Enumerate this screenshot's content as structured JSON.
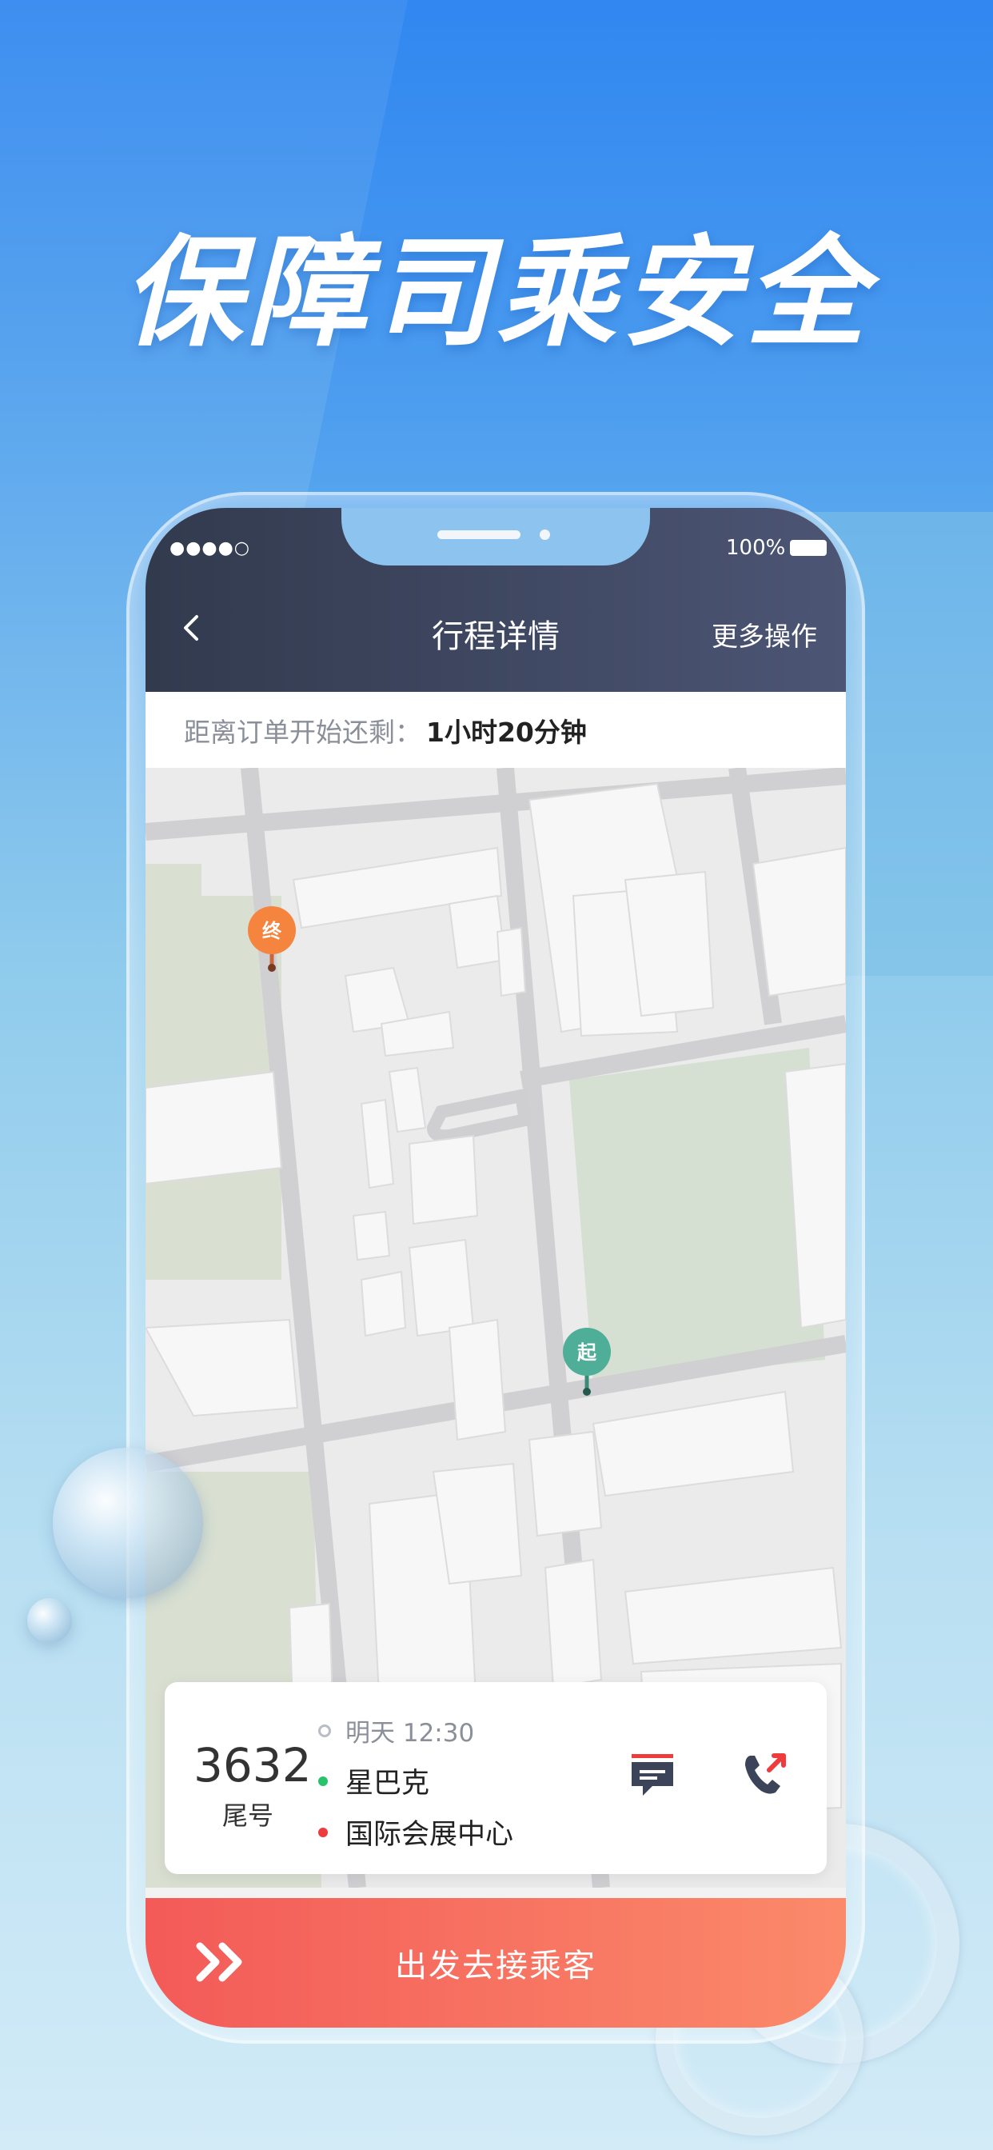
{
  "headline": "保障司乘安全",
  "status_bar": {
    "signal": "●●●●○",
    "battery_text": "100%"
  },
  "nav": {
    "title": "行程详情",
    "more_label": "更多操作"
  },
  "countdown": {
    "label": "距离订单开始还剩：",
    "value": "1小时20分钟"
  },
  "map": {
    "end_marker": "终",
    "start_marker": "起",
    "end_color": "#f5843f",
    "start_color": "#4fae98"
  },
  "trip": {
    "plate_number": "3632",
    "plate_sub": "尾号",
    "time": "明天 12:30",
    "from": "星巴克",
    "to": "国际会展中心",
    "from_color": "#27c26a",
    "to_color": "#ee3b3b"
  },
  "actions": {
    "message_icon": "message-icon",
    "call_icon": "phone-call-icon"
  },
  "go_button": {
    "label": "出发去接乘客"
  }
}
